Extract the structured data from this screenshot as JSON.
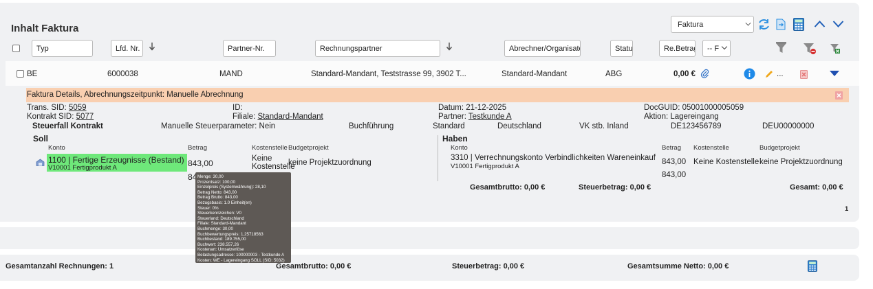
{
  "header": {
    "title": "Inhalt Faktura",
    "select_value": "Faktura"
  },
  "filters": {
    "typ": "Typ",
    "lfd_nr": "Lfd. Nr.",
    "partner_nr": "Partner-Nr.",
    "rechnungspartner": "Rechnungspartner",
    "abrechner": "Abrechner/Organisator",
    "status": "Statu",
    "re_betrag": "Re.Betrag",
    "select_f": "-- F"
  },
  "row": {
    "typ": "BE",
    "lfd_nr": "6000038",
    "partner_nr": "MAND",
    "rechnungspartner": "Standard-Mandant, Teststrasse 99, 3902 T...",
    "abrechner": "Standard-Mandant",
    "status": "ABG",
    "betrag": "0,00 €",
    "more": "..."
  },
  "details": {
    "bar_title": "Faktura Details, Abrechnungszeitpunkt: Manuelle Abrechnung",
    "trans_sid_label": "Trans. SID:",
    "trans_sid": "5059",
    "kontrakt_sid_label": "Kontrakt SID:",
    "kontrakt_sid": "5077",
    "id_label": "ID:",
    "filiale_label": "Filiale:",
    "filiale": "Standard-Mandant",
    "datum": "Datum: 21-12-2025",
    "partner_label": "Partner:",
    "partner": "Testkunde A",
    "docguid": "DocGUID: 05001000005059",
    "aktion": "Aktion: Lagereingang",
    "steuerfall": "Steuerfall Kontrakt",
    "manuelle": "Manuelle Steuerparameter: Nein",
    "buchfuehrung": "Buchführung",
    "standard": "Standard",
    "deutschland": "Deutschland",
    "vk": "VK stb. Inland",
    "de_nr": "DE123456789",
    "deu_nr": "DEU00000000"
  },
  "soll": {
    "title": "Soll",
    "col_konto": "Konto",
    "col_betrag": "Betrag",
    "col_kostenstelle": "Kostenstelle",
    "col_budget": "Budgetprojekt",
    "konto": "1100 | Fertige Erzeugnisse (Bestand)",
    "konto_sub": "V10001 Fertigprodukt A",
    "betrag": "843,00",
    "betrag2": "84",
    "kostenstelle": "Keine Kostenstelle",
    "budget": "keine Projektzuordnung"
  },
  "haben": {
    "title": "Haben",
    "col_konto": "Konto",
    "col_betrag": "Betrag",
    "col_kostenstelle": "Kostenstelle",
    "col_budget": "Budgetprojekt",
    "konto": "3310 | Verrechnungskonto Verbindlichkeiten Wareneinkauf",
    "konto_sub": "V10001 Fertigprodukt A",
    "betrag": "843,00",
    "betrag2": "843,00",
    "kostenstelle": "Keine Kostenstelle",
    "budget": "keine Projektzuordnung"
  },
  "sums": {
    "gesamtbrutto": "Gesamtbrutto: 0,00 €",
    "steuerbetrag": "Steuerbetrag: 0,00 €",
    "gesamt": "Gesamt: 0,00 €",
    "page": "1"
  },
  "tooltip": [
    "Menge: 30,00",
    "Prozentsatz: 100,00",
    "Einzelpreis (Systemwährung): 28,10",
    "Betrag Netto: 843,00",
    "Betrag Brutto: 843,00",
    "Bezugsbasis: 1.0 Einheit(en)",
    "Steuer: 0%",
    "Steuerkennzeichen: V0",
    "Steuerland: Deutschland",
    "Filiale: Standard-Mandant",
    "Buchmenge: 30,00",
    "Buchbewertungspreis: 1,25718563",
    "Buchbestand: 189.755,00",
    "Buchwert: 238.557,26",
    "Kostenart: Umsatzerlöse",
    "Belastungsadresse: 100000003 - Testkunde A",
    "Kosten: WE - Lagereingang SOLL (SID: 5032)"
  ],
  "footer": {
    "anzahl": "Gesamtanzahl Rechnungen: 1",
    "gesamtbrutto": "Gesamtbrutto: 0,00 €",
    "steuerbetrag": "Steuerbetrag: 0,00 €",
    "netto": "Gesamtsumme Netto: 0,00 €"
  },
  "colors": {
    "accent_blue": "#1f6fd6",
    "detail_bar": "#f9cfb0",
    "konto_highlight": "#6ee87a",
    "tooltip_bg": "#5e5955"
  }
}
